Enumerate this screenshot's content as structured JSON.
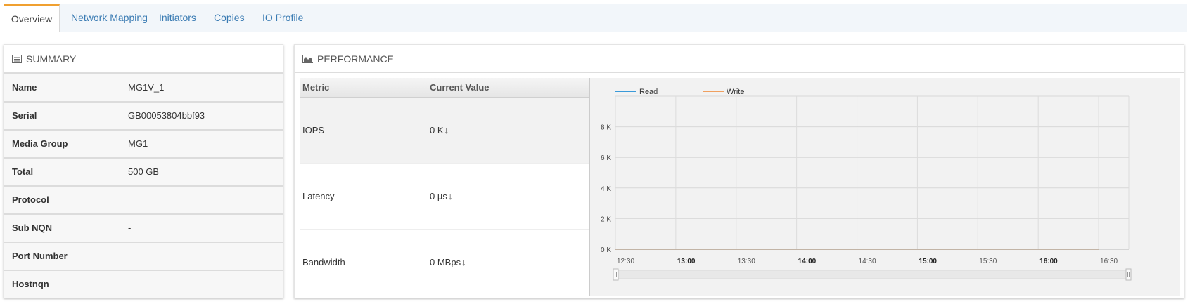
{
  "tabs": [
    {
      "label": "Overview",
      "active": true
    },
    {
      "label": "Network Mapping",
      "active": false
    },
    {
      "label": "Initiators",
      "active": false
    },
    {
      "label": "Copies",
      "active": false
    },
    {
      "label": "IO Profile",
      "active": false
    }
  ],
  "summary": {
    "title": "SUMMARY",
    "icon": "list-icon",
    "rows": [
      {
        "key": "Name",
        "value": "MG1V_1"
      },
      {
        "key": "Serial",
        "value": "GB00053804bbf93"
      },
      {
        "key": "Media Group",
        "value": "MG1"
      },
      {
        "key": "Total",
        "value": "500 GB"
      },
      {
        "key": "Protocol",
        "value": ""
      },
      {
        "key": "Sub NQN",
        "value": "-"
      },
      {
        "key": "Port Number",
        "value": ""
      },
      {
        "key": "Hostnqn",
        "value": ""
      }
    ]
  },
  "performance": {
    "title": "PERFORMANCE",
    "icon": "area-chart-icon",
    "col_metric": "Metric",
    "col_value": "Current Value",
    "metrics": [
      {
        "name": "IOPS",
        "value": "0 K",
        "trend": "↓"
      },
      {
        "name": "Latency",
        "value": "0 µs",
        "trend": "↓"
      },
      {
        "name": "Bandwidth",
        "value": "0 MBps",
        "trend": "↓"
      }
    ]
  },
  "colors": {
    "read": "#3a9ad9",
    "write": "#f0a060",
    "tab_accent": "#f0a030",
    "link": "#3a7bb3"
  },
  "chart_data": {
    "type": "line",
    "title": "",
    "xlabel": "",
    "ylabel": "",
    "series": [
      {
        "name": "Read",
        "values": [
          0,
          0,
          0,
          0,
          0,
          0,
          0,
          0,
          0
        ]
      },
      {
        "name": "Write",
        "values": [
          0,
          0,
          0,
          0,
          0,
          0,
          0,
          0,
          0
        ]
      }
    ],
    "x": [
      "12:30",
      "13:00",
      "13:30",
      "14:00",
      "14:30",
      "15:00",
      "15:30",
      "16:00",
      "16:30"
    ],
    "x_bold": [
      "13:00",
      "14:00",
      "15:00",
      "16:00"
    ],
    "y_ticks": [
      0,
      2000,
      4000,
      6000,
      8000
    ],
    "y_tick_labels": [
      "0 K",
      "2 K",
      "4 K",
      "6 K",
      "8 K"
    ],
    "ylim": [
      0,
      10000
    ],
    "grid": true,
    "legend": "top-left"
  }
}
